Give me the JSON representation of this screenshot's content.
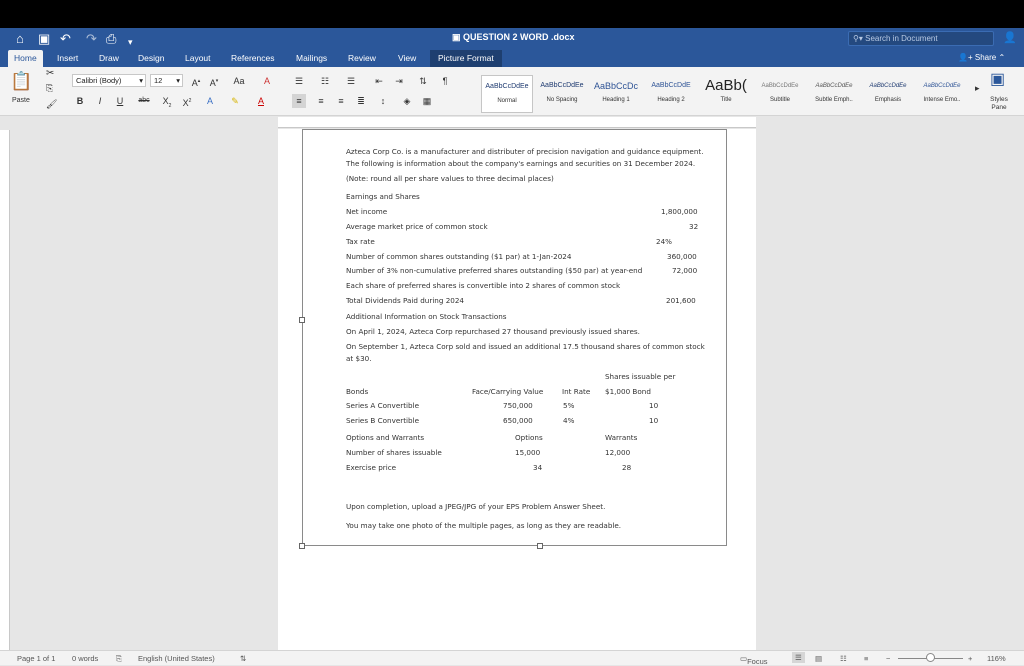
{
  "titlebar": {
    "doc_title": "QUESTION 2 WORD .docx",
    "search_placeholder": "Search in Document"
  },
  "tabs": [
    "Home",
    "Insert",
    "Draw",
    "Design",
    "Layout",
    "References",
    "Mailings",
    "Review",
    "View",
    "Picture Format"
  ],
  "share_label": "Share",
  "ribbon": {
    "paste_label": "Paste",
    "font_name": "Calibri (Body)",
    "font_size": "12",
    "styles": [
      {
        "preview": "AaBbCcDdEe",
        "name": "Normal"
      },
      {
        "preview": "AaBbCcDdEe",
        "name": "No Spacing"
      },
      {
        "preview": "AaBbCcDc",
        "name": "Heading 1"
      },
      {
        "preview": "AaBbCcDdE",
        "name": "Heading 2"
      },
      {
        "preview": "AaBb(",
        "name": "Title"
      },
      {
        "preview": "AaBbCcDdEe",
        "name": "Subtitle"
      },
      {
        "preview": "AaBbCcDdEe",
        "name": "Subtle Emph.."
      },
      {
        "preview": "AaBbCcDdEe",
        "name": "Emphasis"
      },
      {
        "preview": "AaBbCcDdEe",
        "name": "Intense Emo.."
      }
    ],
    "styles_pane_label": "Styles Pane"
  },
  "document": {
    "intro": [
      "Azteca Corp Co. is a manufacturer and distributer of precision navigation and guidance equipment.",
      "The following is information about the company's earnings and securities on 31 December 2024.",
      "(Note: round all per share values to three decimal places)"
    ],
    "section1_title": "Earnings and Shares",
    "net_income_label": "Net income",
    "net_income_value": "1,800,000",
    "avg_price_label": "Average market price of common stock",
    "avg_price_value": "32",
    "tax_rate_label": "Tax rate",
    "tax_rate_value": "24%",
    "common_shares_label": "Number of common shares outstanding ($1 par) at 1-Jan-2024",
    "common_shares_value": "360,000",
    "preferred_shares_label": "Number of 3% non-cumulative preferred shares outstanding ($50 par) at year-end",
    "preferred_shares_value": "72,000",
    "convertible_note": "Each share of preferred shares is convertible into 2 shares of common stock",
    "dividends_label": "Total Dividends Paid during 2024",
    "dividends_value": "201,600",
    "section2_title": "Additional Information on Stock Transactions",
    "april_text": "On April 1, 2024, Azteca Corp repurchased 27 thousand previously issued shares.",
    "sept_text_1": "On September 1, Azteca Corp sold and issued an additional 17.5 thousand shares of common stock",
    "sept_text_2": "at $30.",
    "bonds_header_shares_1": "Shares issuable per",
    "bonds_header": {
      "bonds": "Bonds",
      "face": "Face/Carrying Value",
      "rate": "Int Rate",
      "shares": "$1,000 Bond"
    },
    "bonds": [
      {
        "name": "Series A Convertible",
        "face": "750,000",
        "rate": "5%",
        "shares": "10"
      },
      {
        "name": "Series B Convertible",
        "face": "650,000",
        "rate": "4%",
        "shares": "10"
      }
    ],
    "ow_header": {
      "label": "Options and Warrants",
      "options": "Options",
      "warrants": "Warrants"
    },
    "ow_rows": [
      {
        "label": "Number of shares issuable",
        "options": "15,000",
        "warrants": "12,000"
      },
      {
        "label": "Exercise price",
        "options": "34",
        "warrants": "28"
      }
    ],
    "upload_text": "Upon completion, upload a JPEG/JPG of your EPS Problem Answer Sheet.",
    "photo_text": "You may take one photo of the multiple pages, as long as they are readable."
  },
  "statusbar": {
    "page": "Page 1 of 1",
    "words": "0 words",
    "language": "English (United States)",
    "focus": "Focus",
    "zoom": "116%"
  }
}
